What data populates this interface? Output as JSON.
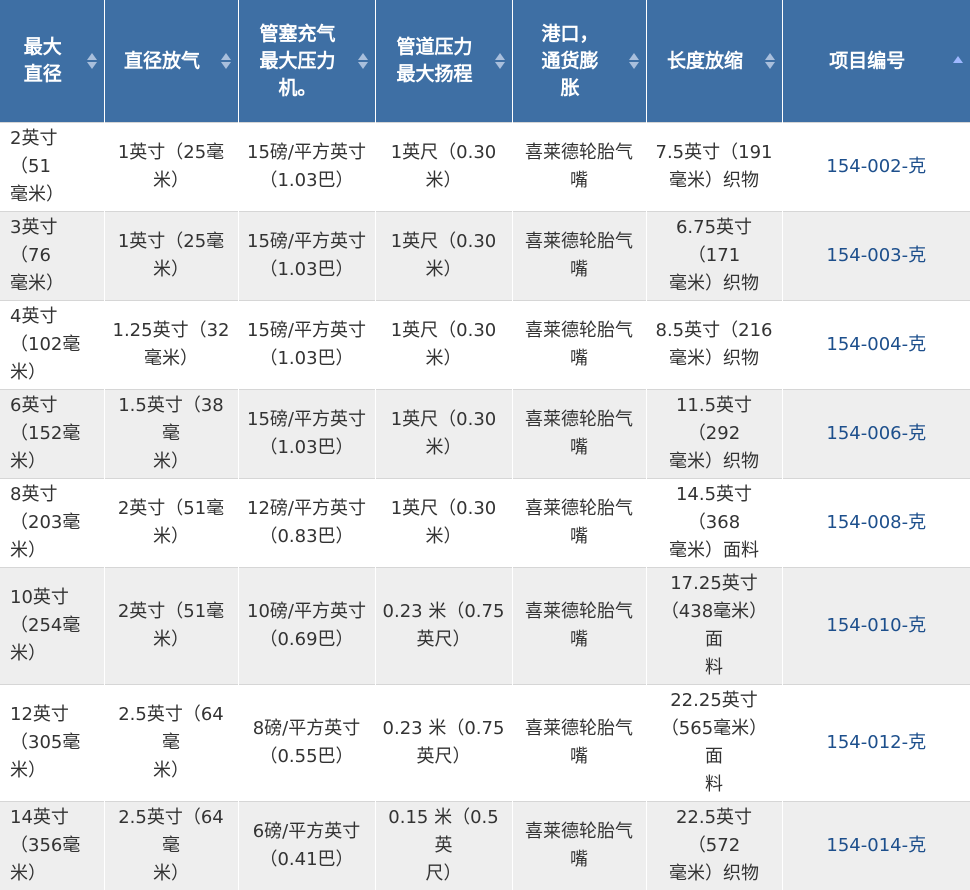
{
  "headers": [
    {
      "label": "最大\n直径",
      "sortable": true
    },
    {
      "label": "直径放气",
      "sortable": true
    },
    {
      "label": "管塞充气\n最大压力\n机。",
      "sortable": true
    },
    {
      "label": "管道压力\n最大扬程",
      "sortable": true
    },
    {
      "label": "港口，\n通货膨\n胀",
      "sortable": true
    },
    {
      "label": "长度放缩",
      "sortable": true
    },
    {
      "label": "项目编号",
      "sortable": true,
      "sorted": "asc"
    }
  ],
  "rows": [
    [
      "2英寸（51\n毫米）",
      "1英寸（25毫\n米）",
      "15磅/平方英寸\n（1.03巴）",
      "1英尺（0.30\n米）",
      "喜莱德轮胎气\n嘴",
      "7.5英寸（191\n毫米）织物",
      "154-002-克"
    ],
    [
      "3英寸（76\n毫米）",
      "1英寸（25毫\n米）",
      "15磅/平方英寸\n（1.03巴）",
      "1英尺（0.30\n米）",
      "喜莱德轮胎气\n嘴",
      "6.75英寸（171\n毫米）织物",
      "154-003-克"
    ],
    [
      "4英寸\n（102毫\n米）",
      "1.25英寸（32\n毫米）",
      "15磅/平方英寸\n（1.03巴）",
      "1英尺（0.30\n米）",
      "喜莱德轮胎气\n嘴",
      "8.5英寸（216\n毫米）织物",
      "154-004-克"
    ],
    [
      "6英寸\n（152毫\n米）",
      "1.5英寸（38毫\n米）",
      "15磅/平方英寸\n（1.03巴）",
      "1英尺（0.30\n米）",
      "喜莱德轮胎气\n嘴",
      "11.5英寸（292\n毫米）织物",
      "154-006-克"
    ],
    [
      "8英寸\n（203毫\n米）",
      "2英寸（51毫\n米）",
      "12磅/平方英寸\n（0.83巴）",
      "1英尺（0.30\n米）",
      "喜莱德轮胎气\n嘴",
      "14.5英寸（368\n毫米）面料",
      "154-008-克"
    ],
    [
      "10英寸\n（254毫\n米）",
      "2英寸（51毫\n米）",
      "10磅/平方英寸\n（0.69巴）",
      "0.23 米（0.75\n英尺）",
      "喜莱德轮胎气\n嘴",
      "17.25英寸\n（438毫米）面\n料",
      "154-010-克"
    ],
    [
      "12英寸\n（305毫\n米）",
      "2.5英寸（64毫\n米）",
      "8磅/平方英寸\n（0.55巴）",
      "0.23 米（0.75\n英尺）",
      "喜莱德轮胎气\n嘴",
      "22.25英寸\n（565毫米）面\n料",
      "154-012-克"
    ],
    [
      "14英寸\n（356毫\n米）",
      "2.5英寸（64毫\n米）",
      "6磅/平方英寸\n（0.41巴）",
      "0.15 米（0.5 英\n尺）",
      "喜莱德轮胎气\n嘴",
      "22.5英寸（572\n毫米）织物",
      "154-014-克"
    ]
  ]
}
